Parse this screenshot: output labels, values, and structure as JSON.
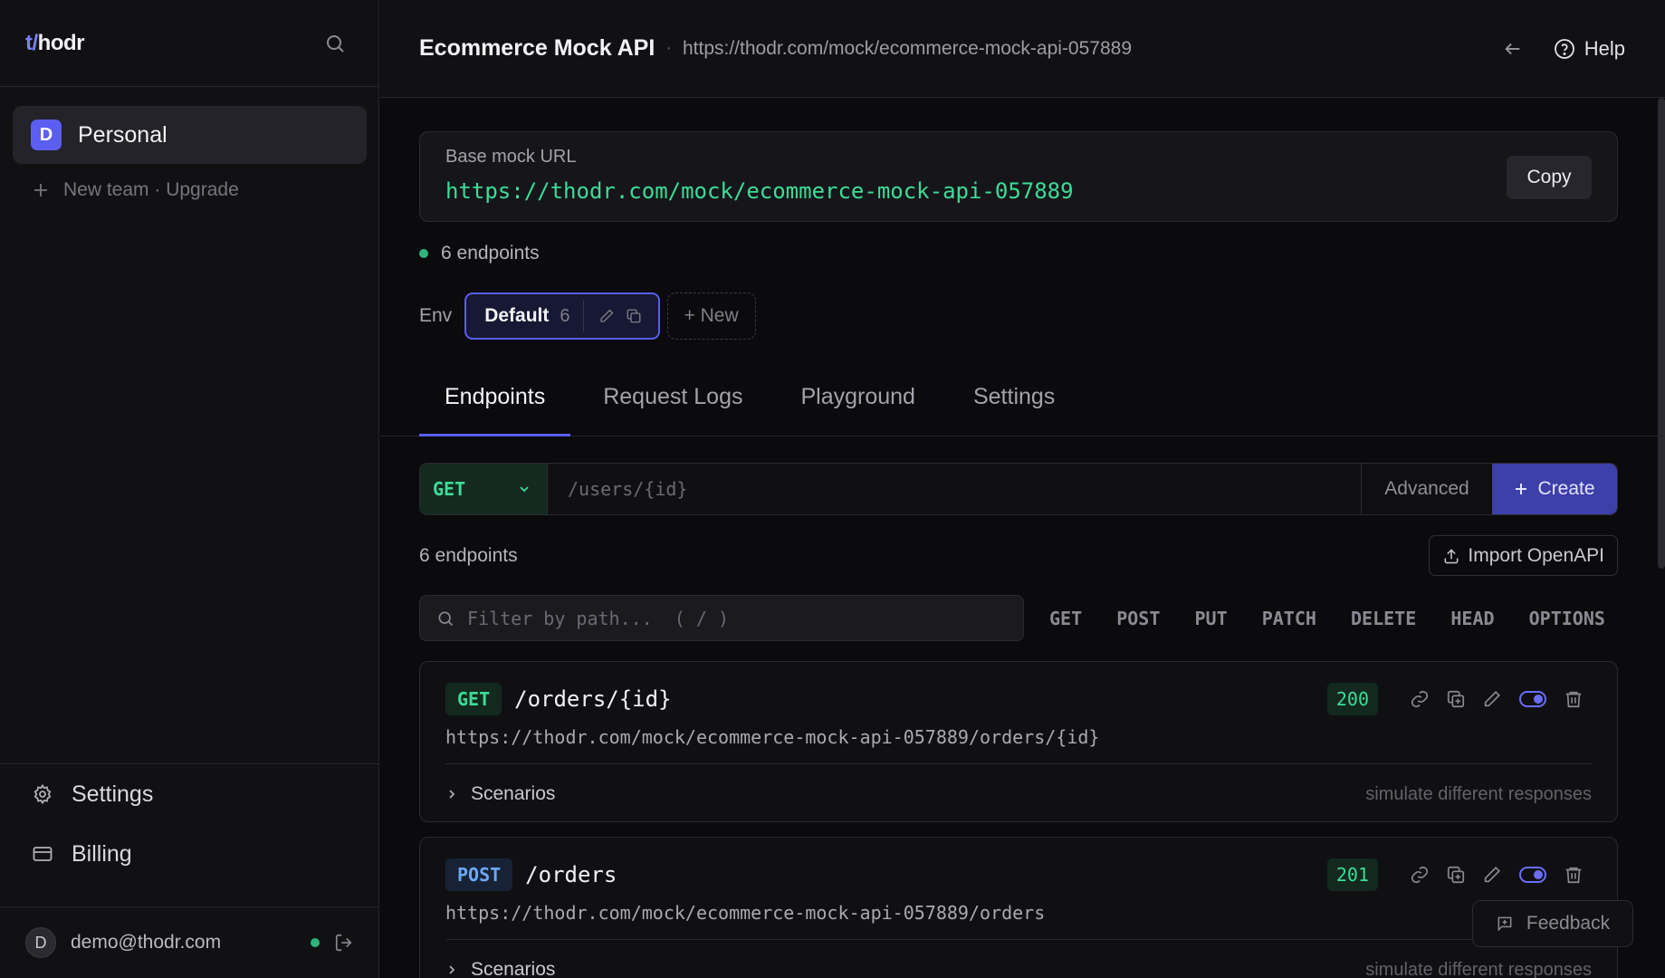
{
  "sidebar": {
    "logo_prefix": "t/",
    "logo_suffix": "hodr",
    "team": {
      "avatar": "D",
      "name": "Personal"
    },
    "new_team": "New team · Upgrade",
    "nav": [
      {
        "label": "Settings",
        "icon": "gear-icon"
      },
      {
        "label": "Billing",
        "icon": "credit-card-icon"
      }
    ],
    "user": {
      "avatar": "D",
      "email": "demo@thodr.com"
    }
  },
  "header": {
    "title": "Ecommerce Mock API",
    "separator": "·",
    "url": "https://thodr.com/mock/ecommerce-mock-api-057889",
    "help": "Help"
  },
  "base": {
    "label": "Base mock URL",
    "url": "https://thodr.com/mock/ecommerce-mock-api-057889",
    "copy": "Copy",
    "endpoint_count": "6 endpoints"
  },
  "env": {
    "label": "Env",
    "name": "Default",
    "count": "6",
    "new": "+ New"
  },
  "tabs": [
    "Endpoints",
    "Request Logs",
    "Playground",
    "Settings"
  ],
  "create": {
    "method": "GET",
    "path_placeholder": "/users/{id}",
    "advanced": "Advanced",
    "create": "Create"
  },
  "list": {
    "count": "6 endpoints",
    "import": "Import OpenAPI",
    "filter_placeholder": "Filter by path...  ( / )",
    "methods": [
      "GET",
      "POST",
      "PUT",
      "PATCH",
      "DELETE",
      "HEAD",
      "OPTIONS"
    ]
  },
  "endpoints": [
    {
      "method": "GET",
      "path": "/orders/{id}",
      "status": "200",
      "url": "https://thodr.com/mock/ecommerce-mock-api-057889/orders/{id}",
      "scenarios": "Scenarios",
      "hint": "simulate different responses"
    },
    {
      "method": "POST",
      "path": "/orders",
      "status": "201",
      "url": "https://thodr.com/mock/ecommerce-mock-api-057889/orders",
      "scenarios": "Scenarios",
      "hint": "simulate different responses"
    }
  ],
  "feedback": "Feedback",
  "colors": {
    "accent": "#5b5ef0",
    "success": "#3ddc97",
    "post": "#6fa7f5",
    "background": "#0b0b0e"
  }
}
